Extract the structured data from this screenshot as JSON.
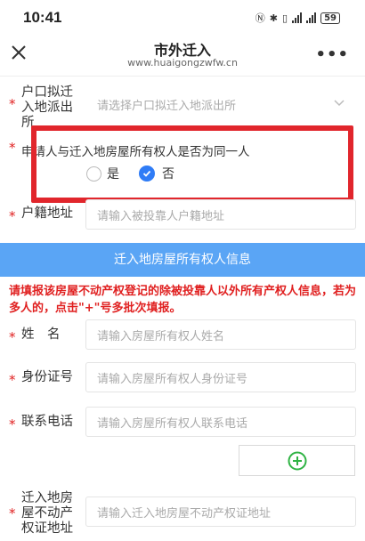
{
  "status": {
    "time": "10:41",
    "battery": "59"
  },
  "header": {
    "title": "市外迁入",
    "subtitle": "www.huaigongzwfw.cn"
  },
  "form": {
    "police_station": {
      "label": "户口拟迁入地派出所",
      "placeholder": "请选择户口拟迁入地派出所"
    },
    "same_person": {
      "question": "申请人与迁入地房屋所有权人是否为同一人",
      "options": [
        "是",
        "否"
      ],
      "selected": "否"
    },
    "domicile": {
      "label": "户籍地址",
      "placeholder": "请输入被投靠人户籍地址"
    }
  },
  "section": {
    "title": "迁入地房屋所有权人信息"
  },
  "notice": "请填报该房屋不动产权登记的除被投靠人以外所有产权人信息，若为多人的，点击\"+\"号多批次填报。",
  "owner": {
    "name": {
      "label": "姓　名",
      "placeholder": "请输入房屋所有权人姓名"
    },
    "id_number": {
      "label": "身份证号",
      "placeholder": "请输入房屋所有权人身份证号"
    },
    "phone": {
      "label": "联系电话",
      "placeholder": "请输入房屋所有权人联系电话"
    },
    "certificate": {
      "label": "迁入地房屋不动产权证地址",
      "placeholder": "请输入迁入地房屋不动产权证地址"
    }
  },
  "colors": {
    "accent": "#2f7cf6",
    "section_bar": "#5aa5f5",
    "required": "#e02020",
    "highlight": "#e1262c",
    "add": "#2fb344"
  }
}
